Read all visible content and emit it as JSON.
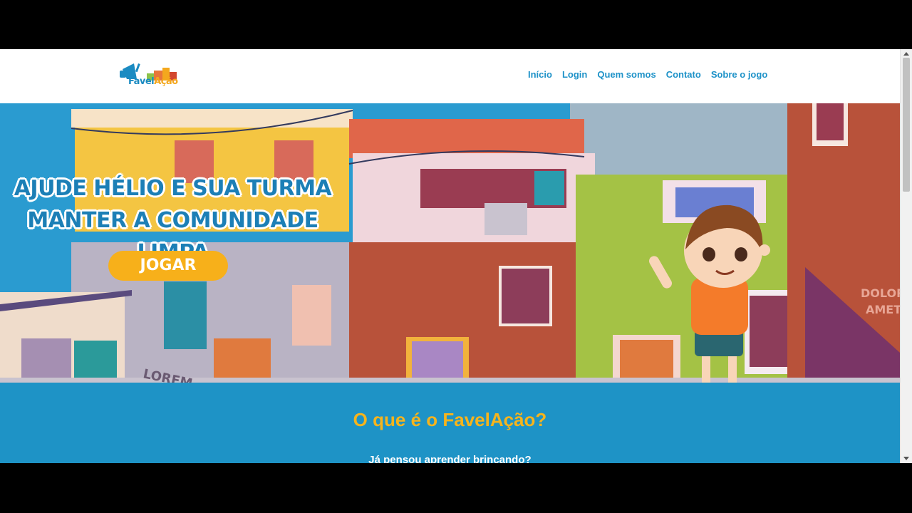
{
  "header": {
    "logo_text_a": "Favel",
    "logo_text_b": "Ação",
    "nav": [
      {
        "label": "Início"
      },
      {
        "label": "Login"
      },
      {
        "label": "Quem somos"
      },
      {
        "label": "Contato"
      },
      {
        "label": "Sobre o jogo"
      }
    ]
  },
  "hero": {
    "headline_line1": "AJUDE HÉLIO E SUA TURMA",
    "headline_line2": "MANTER A COMUNIDADE LIMPA",
    "play_label": "JOGAR",
    "wall_text_1": "LOREM",
    "wall_text_2": "DOLOR",
    "wall_text_3": "AMET"
  },
  "about": {
    "title": "O que é o FavelAção?",
    "text": "Já pensou aprender brincando?"
  },
  "colors": {
    "brand_blue": "#1e93c6",
    "accent_yellow": "#f7b01a"
  }
}
